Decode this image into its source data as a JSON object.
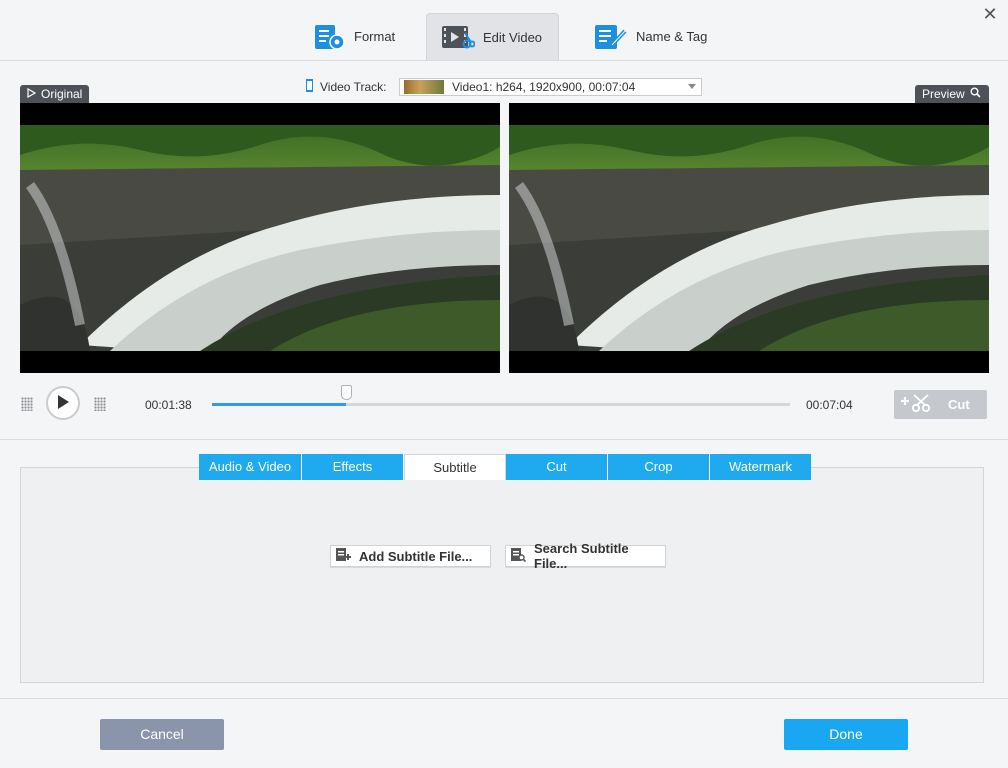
{
  "steps": [
    {
      "label": "Format",
      "icon": "format-settings-icon"
    },
    {
      "label": "Edit Video",
      "icon": "edit-video-icon"
    },
    {
      "label": "Name & Tag",
      "icon": "name-tag-icon"
    }
  ],
  "active_step": "Edit Video",
  "close_symbol": "✕",
  "original_label": "Original",
  "preview_label": "Preview",
  "video_track": {
    "label": "Video Track:",
    "value": "Video1: h264, 1920x900, 00:07:04"
  },
  "playback": {
    "current_time": "00:01:38",
    "total_time": "00:07:04",
    "progress": 0.231,
    "cut_label": "Cut"
  },
  "tabs": [
    "Audio & Video",
    "Effects",
    "Subtitle",
    "Cut",
    "Crop",
    "Watermark"
  ],
  "active_tab": "Subtitle",
  "subtitle": {
    "add_label": "Add Subtitle File...",
    "search_label": "Search Subtitle File..."
  },
  "footer": {
    "cancel_label": "Cancel",
    "done_label": "Done"
  },
  "colors": {
    "accent": "#1faaf0",
    "done": "#18a7f0",
    "cancel": "#8a94ab",
    "tag_bg": "#4d5258",
    "cut_disabled": "#c5c8cc"
  }
}
